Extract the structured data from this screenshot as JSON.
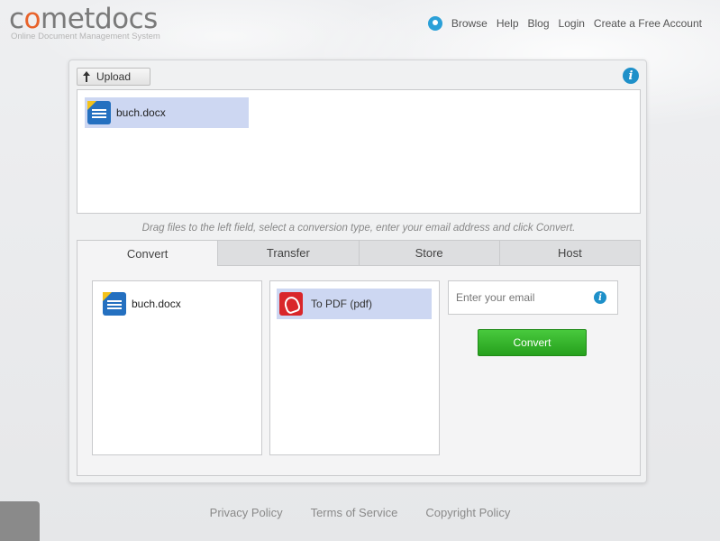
{
  "brand": {
    "logo_c": "c",
    "logo_o": "o",
    "logo_rest": "metdocs",
    "tagline": "Online Document Management System",
    "accent_color": "#e8622a"
  },
  "topnav": {
    "icon": "lightbulb-icon",
    "items": [
      "Browse",
      "Help",
      "Blog",
      "Login",
      "Create a Free Account"
    ]
  },
  "uploader": {
    "upload_label": "Upload",
    "files": [
      {
        "name": "buch.docx",
        "icon": "word-document-icon"
      }
    ]
  },
  "hint": "Drag files to the left field, select a conversion type, enter your email address and click Convert.",
  "tabs": {
    "items": [
      "Convert",
      "Transfer",
      "Store",
      "Host"
    ],
    "active": "Convert"
  },
  "convert": {
    "selected_file": "buch.docx",
    "conversion_type": "To PDF (pdf)",
    "email_placeholder": "Enter your email",
    "email_value": "",
    "button_label": "Convert",
    "button_color": "#2fb126"
  },
  "footer": {
    "links": [
      "Privacy Policy",
      "Terms of Service",
      "Copyright Policy"
    ]
  }
}
